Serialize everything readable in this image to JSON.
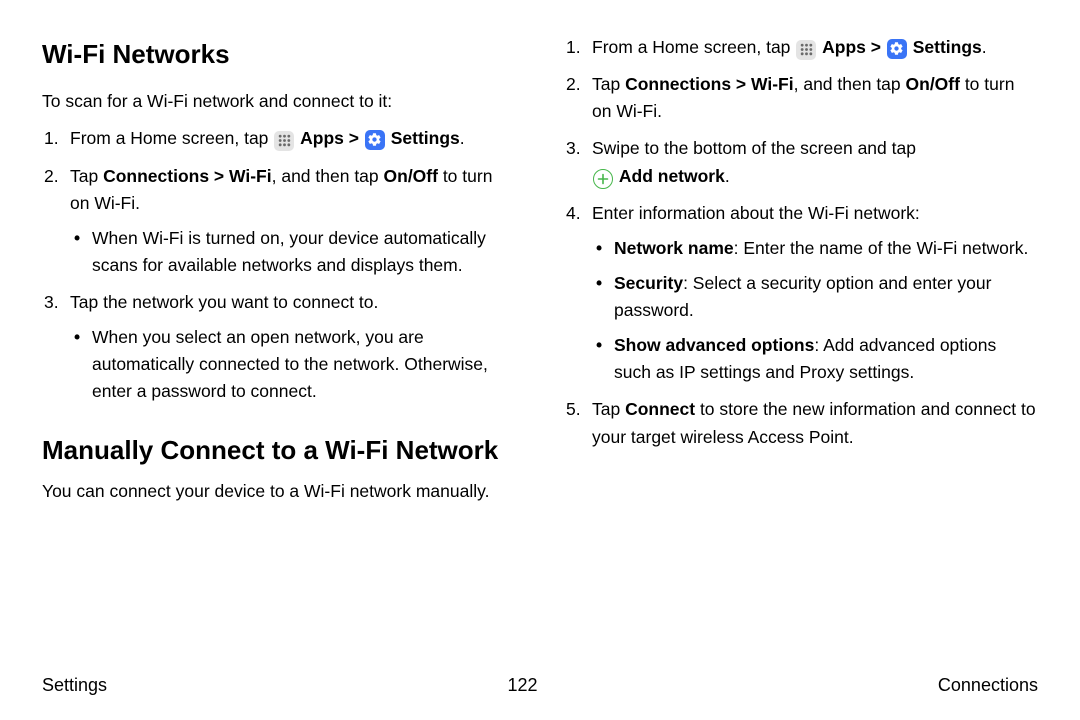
{
  "left": {
    "heading1": "Wi‑Fi Networks",
    "intro1": "To scan for a Wi‑Fi network and connect to it:",
    "step1_pre": "From a Home screen, tap ",
    "apps": "Apps",
    "sep": " > ",
    "settings": "Settings",
    "period": ".",
    "step2_a": "Tap ",
    "step2_b": "Connections > Wi‑Fi",
    "step2_c": ", and then tap ",
    "step2_d": "On/Off",
    "step2_e": " to turn on Wi‑Fi.",
    "bullet2": "When Wi‑Fi is turned on, your device automatically scans for available networks and displays them.",
    "step3": "Tap the network you want to connect to.",
    "bullet3": "When you select an open network, you are automatically connected to the network. Otherwise, enter a password to connect.",
    "heading2": "Manually Connect to a Wi‑Fi Network",
    "intro2": "You can connect your device to a Wi‑Fi network manually."
  },
  "right": {
    "step1_pre": "From a Home screen, tap ",
    "step3_a": "Swipe to the bottom of the screen and tap ",
    "addnetwork": "Add network",
    "step4": "Enter information about the Wi‑Fi network:",
    "b4a_label": "Network name",
    "b4a_text": ": Enter the name of the Wi‑Fi network.",
    "b4b_label": "Security",
    "b4b_text": ": Select a security option and enter your password.",
    "b4c_label": "Show advanced options",
    "b4c_text": ": Add advanced options such as IP settings and Proxy settings.",
    "step5_a": "Tap ",
    "step5_b": "Connect",
    "step5_c": " to store the new information and connect to your target wireless Access Point."
  },
  "footer": {
    "left": "Settings",
    "center": "122",
    "right": "Connections"
  }
}
